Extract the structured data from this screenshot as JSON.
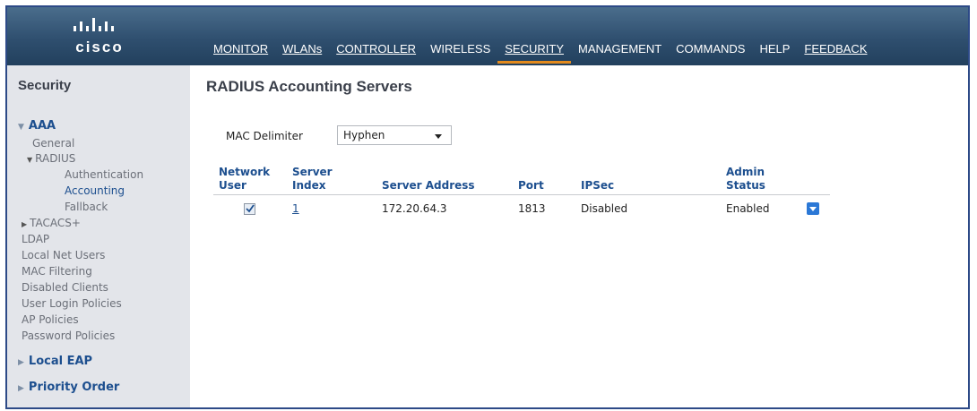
{
  "brand": {
    "logo_text": "cisco",
    "header_color": "#2f4f6f",
    "active_tab_color": "#e38a1d"
  },
  "menu": {
    "items": [
      {
        "label": "MONITOR"
      },
      {
        "label": "WLANs"
      },
      {
        "label": "CONTROLLER"
      },
      {
        "label": "WIRELESS"
      },
      {
        "label": "SECURITY",
        "active": true
      },
      {
        "label": "MANAGEMENT"
      },
      {
        "label": "COMMANDS"
      },
      {
        "label": "HELP"
      },
      {
        "label": "FEEDBACK"
      }
    ]
  },
  "sidebar": {
    "title": "Security",
    "aaa": "AAA",
    "general": "General",
    "radius": "RADIUS",
    "authentication": "Authentication",
    "accounting": "Accounting",
    "fallback": "Fallback",
    "tacacs": "TACACS+",
    "ldap": "LDAP",
    "local_net_users": "Local Net Users",
    "mac_filtering": "MAC Filtering",
    "disabled_clients": "Disabled Clients",
    "user_login_policies": "User Login Policies",
    "ap_policies": "AP Policies",
    "password_policies": "Password Policies",
    "local_eap": "Local EAP",
    "priority_order": "Priority Order"
  },
  "main": {
    "title": "RADIUS Accounting Servers",
    "mac_delimiter_label": "MAC Delimiter",
    "mac_delimiter_value": "Hyphen",
    "table": {
      "headers": {
        "network_user": [
          "Network",
          "User"
        ],
        "server_index": [
          "Server",
          "Index"
        ],
        "server_address": "Server Address",
        "port": "Port",
        "ipsec": "IPSec",
        "admin_status": [
          "Admin",
          "Status"
        ]
      },
      "rows": [
        {
          "network_user_checked": true,
          "server_index": "1",
          "server_address": "172.20.64.3",
          "port": "1813",
          "ipsec": "Disabled",
          "admin_status": "Enabled"
        }
      ]
    }
  }
}
